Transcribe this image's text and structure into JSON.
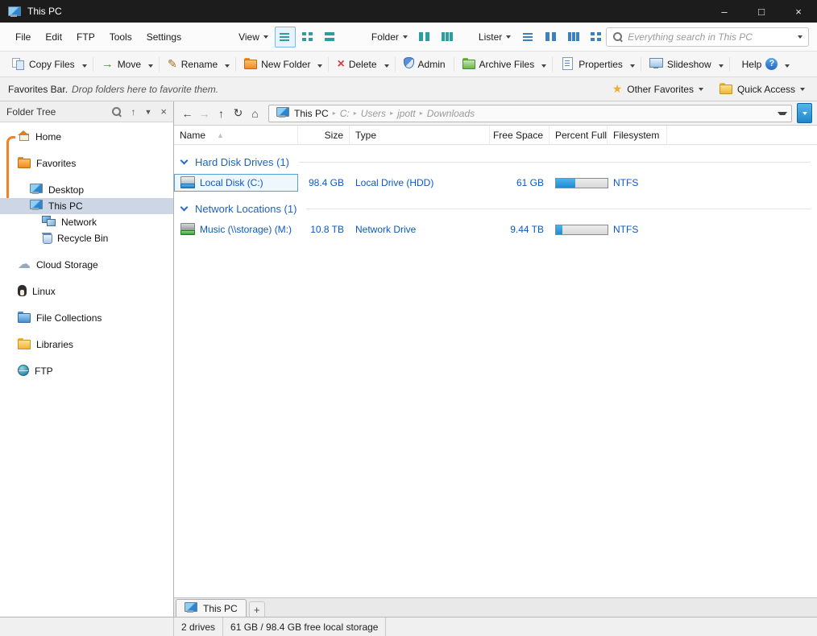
{
  "window": {
    "title": "This PC",
    "controls": {
      "minimize": "–",
      "maximize": "□",
      "close": "×"
    }
  },
  "menubar": {
    "menus": [
      "File",
      "Edit",
      "FTP",
      "Tools",
      "Settings"
    ],
    "view": {
      "label": "View",
      "buttons": [
        "details-view-icon",
        "thumbnails-view-icon",
        "tiles-view-icon"
      ],
      "selected_index": 0
    },
    "folder": {
      "label": "Folder",
      "buttons": [
        "folder-columns-icon",
        "folder-tiles-icon"
      ]
    },
    "lister": {
      "label": "Lister",
      "buttons": [
        "lister-layout-1-icon",
        "lister-layout-2-icon",
        "lister-layout-3-icon",
        "lister-layout-4-icon"
      ]
    },
    "search": {
      "placeholder": "Everything search in This PC"
    }
  },
  "toolbar": {
    "buttons": [
      {
        "label": "Copy Files",
        "icon": "copy-icon",
        "dropdown": true
      },
      {
        "label": "Move",
        "icon": "move-icon",
        "dropdown": true
      },
      {
        "label": "Rename",
        "icon": "rename-icon",
        "dropdown": true
      },
      {
        "label": "New Folder",
        "icon": "new-folder-icon",
        "dropdown": true
      },
      {
        "label": "Delete",
        "icon": "delete-icon",
        "dropdown": true
      },
      {
        "label": "Admin",
        "icon": "admin-icon",
        "dropdown": false
      },
      {
        "label": "Archive Files",
        "icon": "archive-icon",
        "dropdown": true
      },
      {
        "label": "Properties",
        "icon": "properties-icon",
        "dropdown": true
      },
      {
        "label": "Slideshow",
        "icon": "slideshow-icon",
        "dropdown": true
      },
      {
        "label": "Help",
        "icon": "help-icon",
        "dropdown": true,
        "icon_after": true
      }
    ]
  },
  "favorites_bar": {
    "title": "Favorites Bar.",
    "hint": "Drop folders here to favorite them.",
    "right": [
      {
        "label": "Other Favorites",
        "icon": "star-icon"
      },
      {
        "label": "Quick Access",
        "icon": "quick-access-folder-icon"
      }
    ]
  },
  "folder_tree": {
    "title": "Folder Tree",
    "items": [
      {
        "label": "Home",
        "icon": "home-icon",
        "indent": 0,
        "gap": false
      },
      {
        "label": "Favorites",
        "icon": "favorites-folder-icon",
        "indent": 0,
        "gap": true
      },
      {
        "label": "Desktop",
        "icon": "desktop-icon",
        "indent": 1,
        "gap": true
      },
      {
        "label": "This PC",
        "icon": "computer-icon",
        "indent": 1,
        "selected": true
      },
      {
        "label": "Network",
        "icon": "network-icon",
        "indent": 2
      },
      {
        "label": "Recycle Bin",
        "icon": "recycle-bin-icon",
        "indent": 2
      },
      {
        "label": "Cloud Storage",
        "icon": "cloud-icon",
        "indent": 0,
        "gap": true
      },
      {
        "label": "Linux",
        "icon": "linux-icon",
        "indent": 0,
        "gap": true
      },
      {
        "label": "File Collections",
        "icon": "collections-icon",
        "indent": 0,
        "gap": true
      },
      {
        "label": "Libraries",
        "icon": "libraries-icon",
        "indent": 0,
        "gap": true
      },
      {
        "label": "FTP",
        "icon": "ftp-icon",
        "indent": 0,
        "gap": true
      }
    ]
  },
  "path_bar": {
    "nav": [
      {
        "name": "back",
        "glyph": "←"
      },
      {
        "name": "forward",
        "glyph": "→",
        "disabled": true
      },
      {
        "name": "up",
        "glyph": "↑"
      },
      {
        "name": "refresh",
        "glyph": "↻"
      },
      {
        "name": "home",
        "glyph": "⌂"
      }
    ],
    "segments": [
      {
        "label": "This PC",
        "ghost": false,
        "icon": "computer-icon"
      },
      {
        "label": "C:",
        "ghost": true
      },
      {
        "label": "Users",
        "ghost": true
      },
      {
        "label": "jpott",
        "ghost": true
      },
      {
        "label": "Downloads",
        "ghost": true
      }
    ]
  },
  "file_list": {
    "columns": [
      {
        "label": "Name",
        "align": "left",
        "sorted": true
      },
      {
        "label": "Size",
        "align": "right"
      },
      {
        "label": "Type",
        "align": "left"
      },
      {
        "label": "Free Space",
        "align": "right"
      },
      {
        "label": "Percent Full",
        "align": "left"
      },
      {
        "label": "Filesystem",
        "align": "left"
      }
    ],
    "groups": [
      {
        "label": "Hard Disk Drives (1)",
        "rows": [
          {
            "name": "Local Disk (C:)",
            "icon": "hdd-icon",
            "size": "98.4 GB",
            "type": "Local Drive (HDD)",
            "free_space": "61 GB",
            "percent_full": 38,
            "filesystem": "NTFS",
            "focused": true
          }
        ]
      },
      {
        "label": "Network Locations (1)",
        "rows": [
          {
            "name": "Music (\\\\storage) (M:)",
            "icon": "network-drive-icon",
            "size": "10.8 TB",
            "type": "Network Drive",
            "free_space": "9.44 TB",
            "percent_full": 13,
            "filesystem": "NTFS",
            "focused": false
          }
        ]
      }
    ]
  },
  "tab_bar": {
    "tabs": [
      {
        "label": "This PC",
        "icon": "computer-icon",
        "active": true
      }
    ],
    "new_tab_label": "+"
  },
  "status_bar": {
    "items": [
      "2 drives",
      "61 GB / 98.4 GB free local storage"
    ]
  },
  "colors": {
    "titlebar": "#1c1c1c",
    "accent_blue": "#1b63c4",
    "row_text_blue": "#0b5ac4",
    "bar_fill": "#2491dd",
    "tree_selection": "#ccd6e4",
    "tree_guide_orange": "#f08424"
  }
}
